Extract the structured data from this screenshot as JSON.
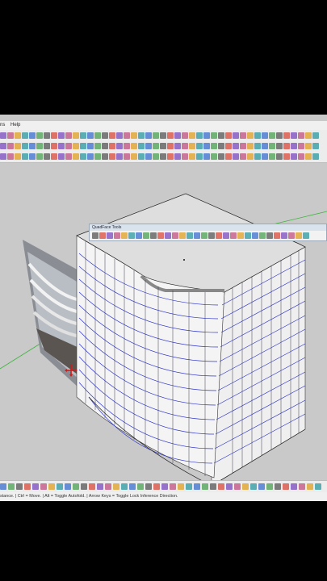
{
  "menu": {
    "items": [
      "ns",
      "Help"
    ]
  },
  "toolbars": {
    "quadface_title": "QuadFace Tools"
  },
  "status": {
    "text": "stance. | Ctrl = Move. | Alt = Toggle Autofold. | Arrow Keys = Toggle Lock Inference Direction."
  },
  "colors": {
    "background": "#c9c9c9",
    "facade_lines": "#2e34c8",
    "mullions": "#3a3a4a",
    "top_face": "#dedede",
    "axis_green": "#3cb43c"
  },
  "icons": [
    "move-cursor-icon",
    "origin-point-icon"
  ]
}
